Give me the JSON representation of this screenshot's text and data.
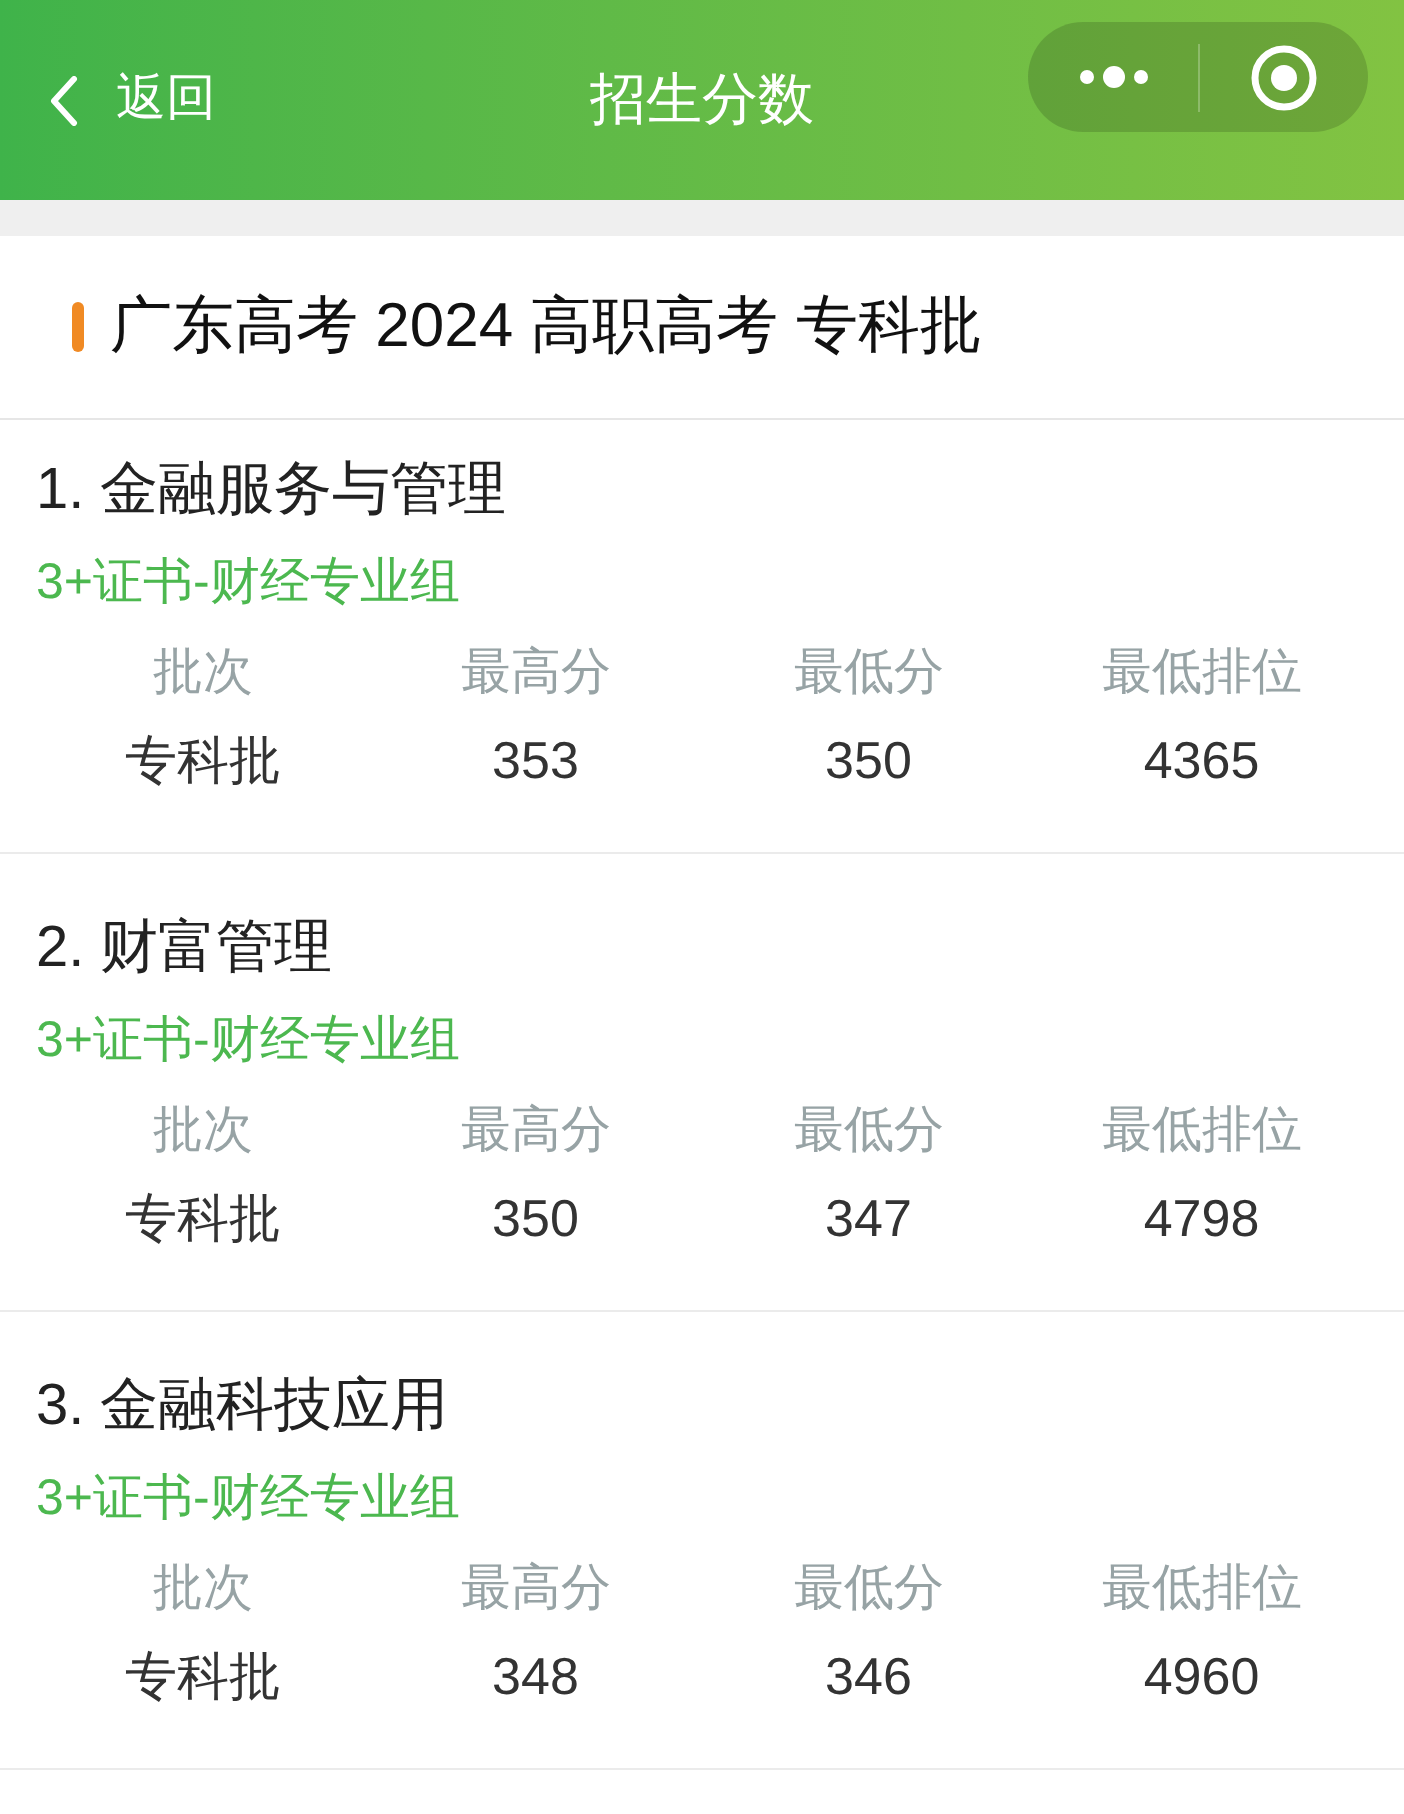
{
  "nav": {
    "back_label": "返回",
    "title": "招生分数"
  },
  "section_title": "广东高考 2024 高职高考 专科批",
  "majors": [
    {
      "title": "1. 金融服务与管理",
      "group": "3+证书-财经专业组",
      "columns": [
        "批次",
        "最高分",
        "最低分",
        "最低排位"
      ],
      "values": [
        "专科批",
        "353",
        "350",
        "4365"
      ]
    },
    {
      "title": "2. 财富管理",
      "group": "3+证书-财经专业组",
      "columns": [
        "批次",
        "最高分",
        "最低分",
        "最低排位"
      ],
      "values": [
        "专科批",
        "350",
        "347",
        "4798"
      ]
    },
    {
      "title": "3. 金融科技应用",
      "group": "3+证书-财经专业组",
      "columns": [
        "批次",
        "最高分",
        "最低分",
        "最低排位"
      ],
      "values": [
        "专科批",
        "348",
        "346",
        "4960"
      ]
    }
  ]
}
